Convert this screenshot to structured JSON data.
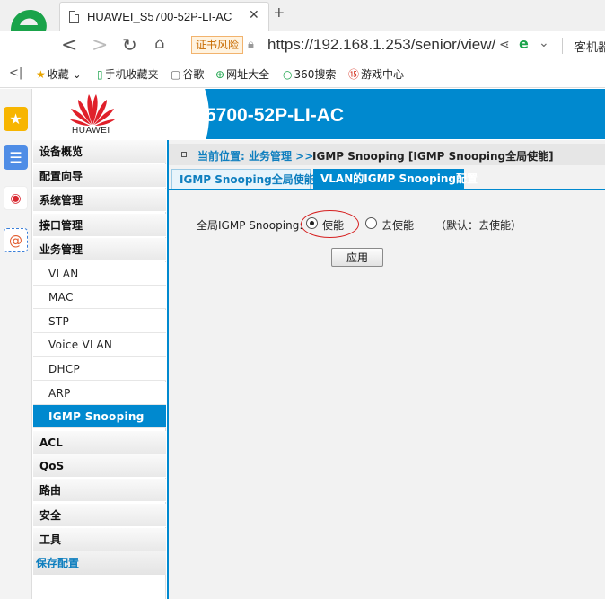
{
  "browser": {
    "tab_title": "HUAWEI_S5700-52P-LI-AC",
    "tab_close": "✕",
    "new_tab": "+",
    "cert_warning": "证书风险",
    "url": "https://192.168.1.253/senior/view/",
    "addr_extra": "客机器",
    "favorites": [
      {
        "icon": "star-icon",
        "glyph": "★",
        "label": "收藏 ⌄"
      },
      {
        "icon": "phone-icon",
        "glyph": "▯",
        "label": "手机收藏夹"
      },
      {
        "icon": "page-icon",
        "glyph": "▢",
        "label": "谷歌"
      },
      {
        "icon": "globe-icon",
        "glyph": "⊕",
        "label": "网址大全"
      },
      {
        "icon": "search-icon",
        "glyph": "○",
        "label": "360搜索"
      },
      {
        "icon": "game-icon",
        "glyph": "⑮",
        "label": "游戏中心"
      }
    ],
    "colors": {
      "accent": "#1aa34a",
      "cert_warning": "#c86b00"
    }
  },
  "header": {
    "logo_text": "HUAWEI",
    "model": "S5700-52P-LI-AC",
    "colors": {
      "banner": "#0089cf",
      "logo_red": "#e0202a"
    }
  },
  "menu": {
    "items": [
      {
        "label": "设备概览",
        "kind": "top"
      },
      {
        "label": "配置向导",
        "kind": "top"
      },
      {
        "label": "系统管理",
        "kind": "top"
      },
      {
        "label": "接口管理",
        "kind": "top"
      },
      {
        "label": "业务管理",
        "kind": "top"
      },
      {
        "label": "VLAN",
        "kind": "sub"
      },
      {
        "label": "MAC",
        "kind": "sub"
      },
      {
        "label": "STP",
        "kind": "sub"
      },
      {
        "label": "Voice VLAN",
        "kind": "sub"
      },
      {
        "label": "DHCP",
        "kind": "sub"
      },
      {
        "label": "ARP",
        "kind": "sub"
      },
      {
        "label": "IGMP Snooping",
        "kind": "sub",
        "active": true
      },
      {
        "label": "ACL",
        "kind": "top"
      },
      {
        "label": "QoS",
        "kind": "top"
      },
      {
        "label": "路由",
        "kind": "top"
      },
      {
        "label": "安全",
        "kind": "top"
      },
      {
        "label": "工具",
        "kind": "top"
      },
      {
        "label": "保存配置",
        "kind": "save"
      }
    ]
  },
  "main": {
    "breadcrumb_prefix": "当前位置: 业务管理 >>",
    "breadcrumb_current": "IGMP Snooping [IGMP Snooping全局使能]",
    "tabs": [
      {
        "label": "IGMP Snooping全局使能",
        "selected": true
      },
      {
        "label": "VLAN的IGMP Snooping配置",
        "selected": false
      }
    ],
    "form": {
      "label": "全局IGMP Snooping:",
      "options": [
        {
          "label": "使能",
          "checked": true
        },
        {
          "label": "去使能",
          "checked": false
        }
      ],
      "default_note": "（默认：去使能）",
      "apply_label": "应用"
    }
  }
}
